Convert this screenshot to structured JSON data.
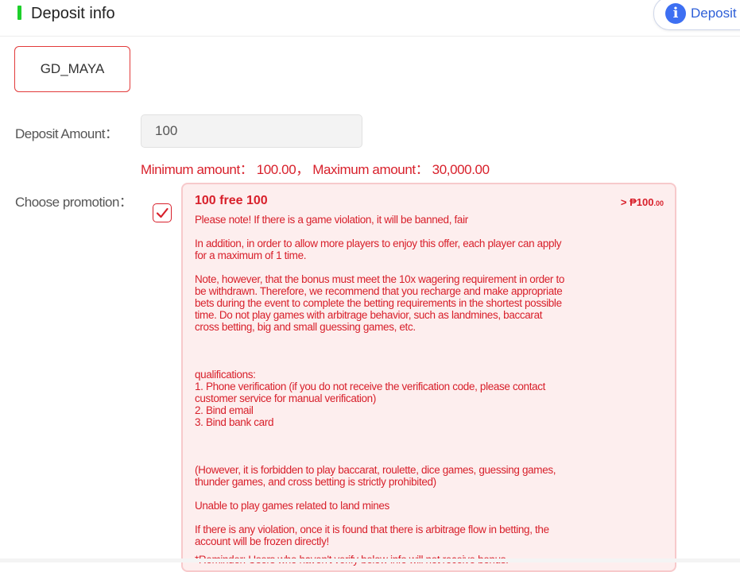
{
  "header": {
    "title": "Deposit info",
    "deposit_button_label": "Deposit",
    "accent_color": "#1ed02b"
  },
  "channel": {
    "label": "GD_MAYA",
    "selected": true
  },
  "amount": {
    "label": "Deposit Amount：",
    "value": "100",
    "limits_text": "Minimum amount： 100.00， Maximum amount： 30,000.00"
  },
  "promotion": {
    "label": "Choose promotion：",
    "checked": true,
    "title": "100 free 100",
    "amount_prefix": "> ₱100",
    "amount_cents": ".00",
    "lines": {
      "l1": "Please note! If there is a game violation, it will be banned, fair",
      "l2": "In addition, in order to allow more players to enjoy this offer, each player can apply",
      "l3": "for a maximum of 1 time.",
      "l4": "Note, however, that the bonus must meet the 10x wagering requirement in order to",
      "l5": "be withdrawn. Therefore, we recommend that you recharge and make appropriate",
      "l6": "bets during the event to complete the betting requirements in the shortest possible",
      "l7": "time. Do not play games with arbitrage behavior, such as landmines, baccarat",
      "l8": "cross betting, big and small guessing games, etc.",
      "l9": "qualifications:",
      "l10": "1. Phone verification (if you do not receive the verification code, please contact",
      "l11": "customer service for manual verification)",
      "l12": "2. Bind email",
      "l13": "3. Bind bank card",
      "l14": "(However, it is forbidden to play baccarat, roulette, dice games, guessing games,",
      "l15": "thunder games, and cross betting is strictly prohibited)",
      "l16": "Unable to play games related to land mines",
      "l17": "If there is any violation, once it is found that there is arbitrage flow in betting, the",
      "l18": "account will be frozen directly!",
      "l19": "*Reminder: Users who haven't verify below info will not receive bonus."
    }
  },
  "colors": {
    "error_red": "#d8202b",
    "card_bg": "#fdeeee",
    "info_blue": "#3d6ff2"
  }
}
